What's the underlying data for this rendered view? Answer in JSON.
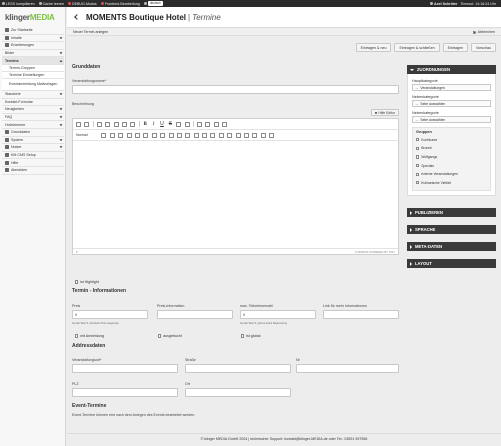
{
  "topbar": {
    "items": [
      "LESS kompilieren",
      "Cache leeren",
      "DEBUG-Modus",
      "Frontend-Bearbeitung"
    ],
    "language": "deutsch",
    "user": "Axel Schröter",
    "timeout": "Timeout: 14:16:24 Uhr"
  },
  "sidebar": {
    "logo_main": "klinger",
    "logo_brand": "MEDIA",
    "items": [
      {
        "label": "Zur Startseite"
      },
      {
        "label": "Inhalte"
      },
      {
        "label": "Erweiterungen"
      },
      {
        "label": "Bilder"
      },
      {
        "label": "Termine"
      },
      {
        "label": "Termin-Gruppen"
      },
      {
        "label": "Termine Einstellungen"
      },
      {
        "label": "Eventanmeldung Mailvorlagen"
      },
      {
        "label": "Standorte"
      },
      {
        "label": "Kontakt-Formular"
      },
      {
        "label": "Neuigkeiten"
      },
      {
        "label": "FAQ"
      },
      {
        "label": "Hotelzimmer"
      },
      {
        "label": "Grunddaten"
      },
      {
        "label": "System"
      },
      {
        "label": "Nutzer"
      },
      {
        "label": "KM CMS Setup"
      },
      {
        "label": "Hilfe"
      },
      {
        "label": "Abmelden"
      }
    ]
  },
  "header": {
    "site": "MOMENTS Boutique Hotel",
    "separator": "|",
    "page": "Termine"
  },
  "actionbar": {
    "left": "Neuer Termin anlegen",
    "cancel": "Abbrechen"
  },
  "buttons": {
    "save_new": "Eintragen & neu",
    "save_close": "Eintragen & schließen",
    "save": "Eintragen",
    "preview": "Vorschau"
  },
  "form": {
    "section_grunddaten": "Grunddaten",
    "name_label": "Veranstaltungsname*",
    "description_label": "Beschreibung",
    "help_editor": "Hilfe Editor",
    "format_select": "Normal",
    "status_left": "P",
    "word_count": "0 WORDS  POWERED BY TINY",
    "highlight_label": "ist Highlight",
    "section_preis": "Termin - Informationen",
    "preis_label": "Preis",
    "preis_value": "0",
    "preis_hint": "bei der Wert 0, wird kein Preis angezeigt",
    "preisinfo_label": "Preis-Information",
    "teilnehmer_label": "max. Teilnehmerzahl",
    "teilnehmer_value": "0",
    "teilnehmer_hint": "bei der Wert 0, gibt es keine Begrenzung",
    "link_label": "Link für mehr Informationen",
    "mit_anmeldung": "mit Anmeldung",
    "ausgebucht": "ausgebucht",
    "ist_global": "ist global",
    "section_adresse": "Addressdaten",
    "veranstaltungsort_label": "Veranstaltungsort*",
    "strasse_label": "Straße",
    "nr_label": "Nr",
    "plz_label": "PLZ",
    "ort_label": "Ort",
    "section_event": "Event-Termine",
    "event_text": "Event-Termine können erst nach dem Anlegen des Events bearbeitet werden."
  },
  "rpanel": {
    "zuordnungen": "ZUORDNUNGEN",
    "hauptkategorie_label": "Hauptkategorie",
    "hauptkategorie_value": "Veranstaltungen",
    "nebenkategorie1_label": "Nebenkategorie",
    "nebenkategorie1_value": "Seite auswählen",
    "nebenkategorie2_label": "Nebenkategorie",
    "nebenkategorie2_value": "Seite auswählen",
    "gruppen_title": "Gruppen",
    "gruppen": [
      "Kochkurse",
      "Brunch",
      "Wolfgangs",
      "Specials",
      "externe Veranstaltungen",
      "Kulinarische Vielfalt"
    ],
    "publizieren": "PUBLIZIEREN",
    "sprache": "SPRACHE",
    "meta": "META-DATEN",
    "layout": "LAYOUT"
  },
  "footer": {
    "text": "© klinger MEDIA GmbH 2024 | technischer Support: kontakt@klinger-MEDIA.de oder Tel.: 03591 597556"
  }
}
